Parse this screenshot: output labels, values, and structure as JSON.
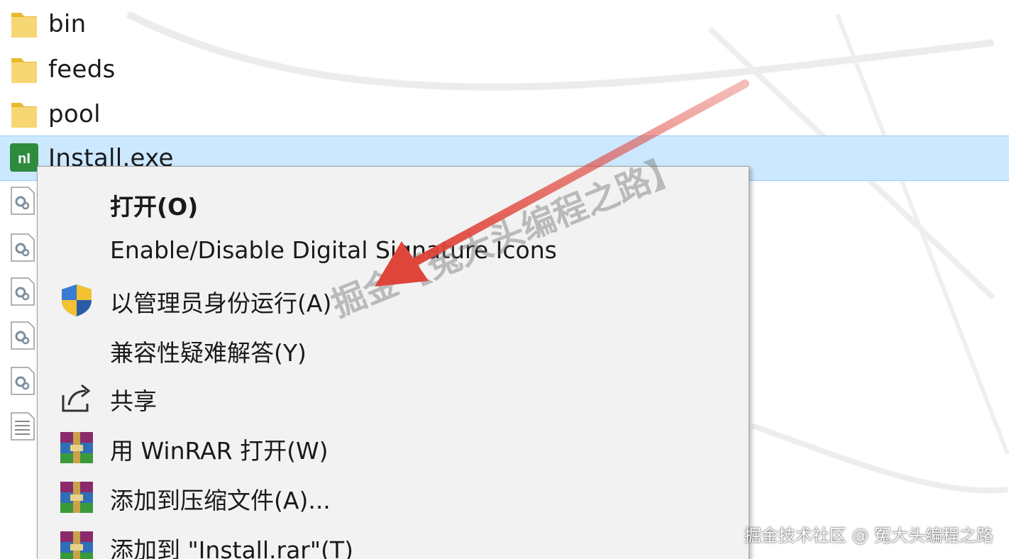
{
  "files": [
    {
      "name": "bin",
      "icon": "folder-icon"
    },
    {
      "name": "feeds",
      "icon": "folder-icon"
    },
    {
      "name": "pool",
      "icon": "folder-icon"
    },
    {
      "name": "Install.exe",
      "icon": "ni-app-icon",
      "selected": true
    }
  ],
  "side_icons": [
    "gear-file-icon",
    "gear-file-icon",
    "gear-file-icon",
    "gear-file-icon",
    "gear-file-icon",
    "text-file-icon"
  ],
  "context_menu": {
    "items": [
      {
        "label": "打开(O)",
        "icon": "",
        "bold": true
      },
      {
        "label": "Enable/Disable Digital Signature Icons",
        "icon": ""
      },
      {
        "label": "以管理员身份运行(A)",
        "icon": "uac-shield-icon"
      },
      {
        "label": "兼容性疑难解答(Y)",
        "icon": ""
      },
      {
        "label": "共享",
        "icon": "share-icon"
      },
      {
        "label": "用 WinRAR 打开(W)",
        "icon": "winrar-icon"
      },
      {
        "label": "添加到压缩文件(A)...",
        "icon": "winrar-icon"
      },
      {
        "label": "添加到 \"Install.rar\"(T)",
        "icon": "winrar-icon"
      }
    ]
  },
  "watermark": "掘金【冤大头编程之路】",
  "corner_watermark": "掘金技术社区 @ 冤大头编程之路",
  "colors": {
    "selection_bg": "#cce8ff",
    "menu_bg": "#f2f2f2",
    "arrow": "#e0453a",
    "folder": "#f5d77a"
  }
}
